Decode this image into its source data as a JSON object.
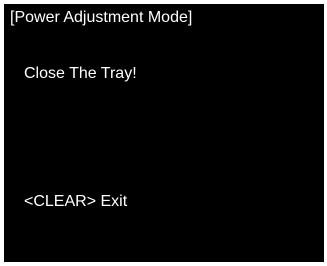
{
  "screen": {
    "title": "[Power Adjustment Mode]",
    "message": "Close The Tray!",
    "exit_hint": "<CLEAR> Exit"
  },
  "colors": {
    "background": "#000000",
    "text": "#ffffff"
  }
}
